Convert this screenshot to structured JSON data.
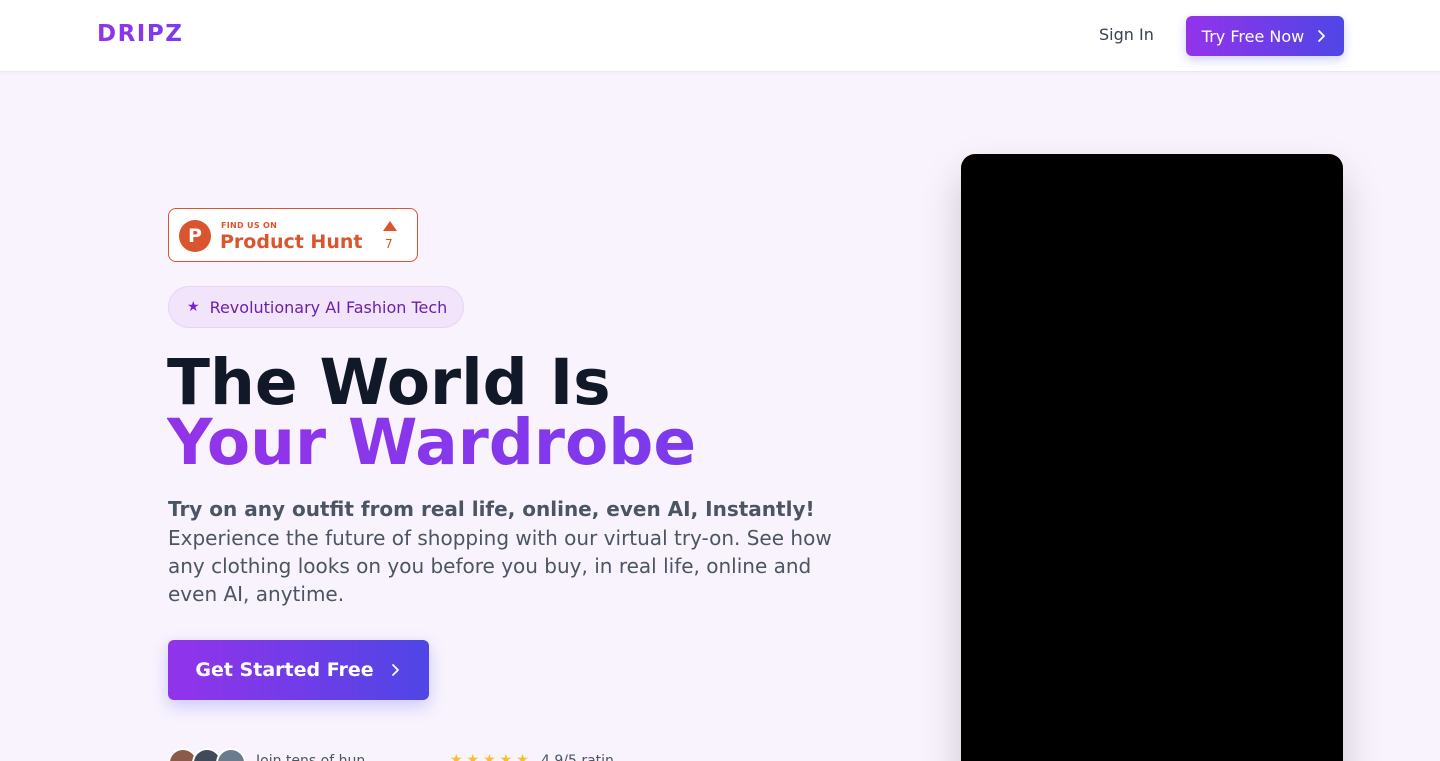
{
  "nav": {
    "logo": "DRIPZ",
    "sign_in": "Sign In",
    "try_free": "Try Free Now",
    "try_free_icon": "chevron-right-icon"
  },
  "product_hunt": {
    "small_text": "FIND US ON",
    "big_text": "Product Hunt",
    "logo_letter": "P",
    "upvote_count": "7",
    "color": "#da552f"
  },
  "hero": {
    "badge_text": "Revolutionary AI Fashion Tech",
    "badge_icon": "star-icon",
    "title_line1": "The World Is",
    "title_line2": "Your Wardrobe",
    "lead": "Try on any outfit from real life, online, even AI, Instantly!",
    "description": "Experience the future of shopping with our virtual try-on. See how any clothing looks on you before you buy, in real life, online and even AI, anytime.",
    "cta": "Get Started Free",
    "cta_icon": "chevron-right-icon",
    "joined_text": "Join tens of hun",
    "rating_stars": "★★★★★",
    "rating_text": "4.9/5 ratin"
  },
  "colors": {
    "accent_start": "#9333ea",
    "accent_end": "#4f46e5",
    "background": "#f8f3fd"
  }
}
